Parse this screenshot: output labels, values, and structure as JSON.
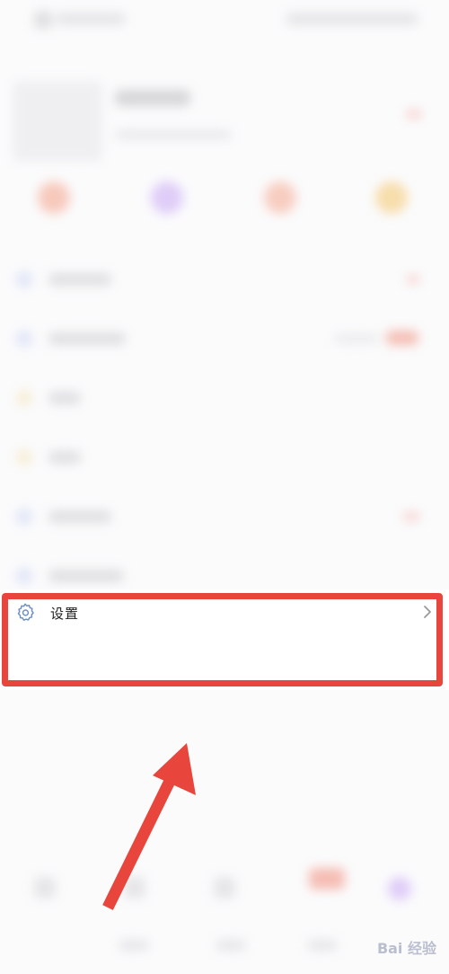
{
  "settings_row": {
    "label": "设置",
    "icon": "settings-gear-icon",
    "chevron_icon": "chevron-right-icon"
  },
  "annotation": {
    "highlight_color": "#e8453c",
    "arrow_color": "#e8453c"
  },
  "watermark": {
    "text": "Bai 经验"
  }
}
